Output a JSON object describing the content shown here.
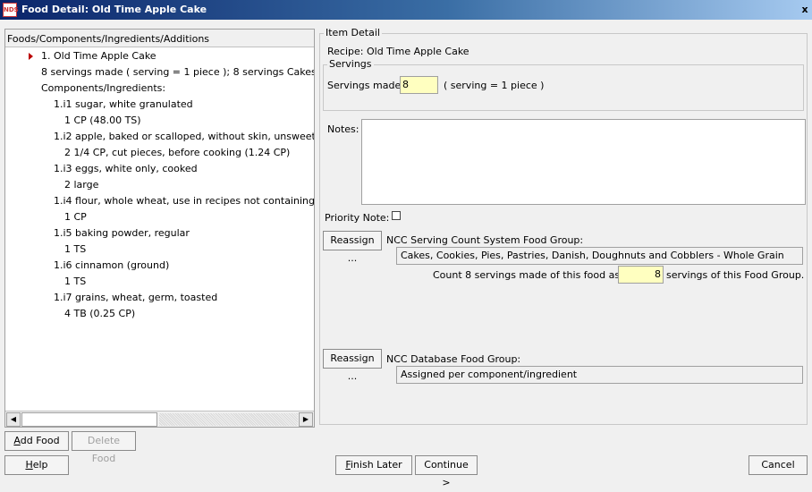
{
  "window": {
    "title": "Food Detail:  Old Time Apple Cake",
    "close_glyph": "x"
  },
  "left_pane": {
    "header": "Foods/Components/Ingredients/Additions",
    "tree": [
      {
        "text": "1.  Old Time Apple Cake"
      },
      {
        "text": "8 servings made ( serving = 1 piece ); 8 servings Cakes,"
      },
      {
        "text": "Components/Ingredients:"
      },
      {
        "text": "1.i1  sugar, white granulated"
      },
      {
        "text": "1 CP (48.00 TS)"
      },
      {
        "text": "1.i2  apple, baked or scalloped, without skin, unsweete"
      },
      {
        "text": "2 1/4 CP, cut pieces, before cooking (1.24 CP)"
      },
      {
        "text": "1.i3  eggs, white only, cooked"
      },
      {
        "text": "2 large"
      },
      {
        "text": "1.i4  flour, whole wheat, use in recipes not containing"
      },
      {
        "text": "1 CP"
      },
      {
        "text": "1.i5  baking powder, regular"
      },
      {
        "text": "1 TS"
      },
      {
        "text": "1.i6  cinnamon (ground)"
      },
      {
        "text": "1 TS"
      },
      {
        "text": "1.i7  grains, wheat, germ, toasted"
      },
      {
        "text": "4 TB (0.25 CP)"
      }
    ]
  },
  "buttons": {
    "add_food": "Add Food",
    "delete_food": "Delete Food",
    "help": "Help",
    "finish_later": "Finish Later",
    "continue": "Continue >",
    "cancel": "Cancel",
    "reassign_1": "Reassign ...",
    "reassign_2": "Reassign ..."
  },
  "item_detail": {
    "legend": "Item Detail",
    "recipe_label": "Recipe: Old Time Apple Cake",
    "servings_legend": "Servings",
    "servings_made_label": "Servings made:",
    "servings_made_value": "8",
    "serving_desc": "( serving = 1 piece )",
    "notes_label": "Notes:",
    "priority_note_label": "Priority Note:",
    "ncc_serving_label": "NCC Serving Count System Food Group:",
    "ncc_serving_value": "Cakes, Cookies, Pies, Pastries, Danish, Doughnuts and Cobblers - Whole Grain",
    "count_prefix": "Count 8 servings made of this food as",
    "count_value": "8",
    "count_suffix": "servings of this Food Group.",
    "ncc_db_label": "NCC Database Food Group:",
    "ncc_db_value": "Assigned per component/ingredient"
  },
  "colors": {
    "title_gradient_start": "#0a246a",
    "input_highlight": "#ffffc0",
    "tree_arrow": "#b00000"
  }
}
